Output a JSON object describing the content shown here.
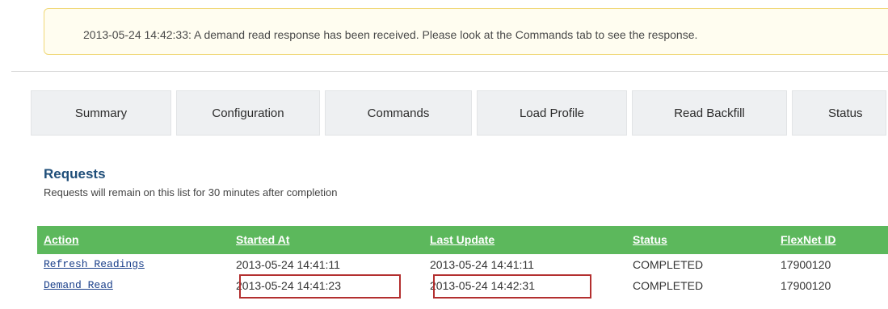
{
  "notice": {
    "text": "2013-05-24 14:42:33: A demand read response has been received. Please look at the Commands tab to see the response."
  },
  "tabs": [
    {
      "label": "Summary"
    },
    {
      "label": "Configuration"
    },
    {
      "label": "Commands"
    },
    {
      "label": "Load Profile"
    },
    {
      "label": "Read Backfill"
    },
    {
      "label": "Status"
    }
  ],
  "requests": {
    "title": "Requests",
    "subtitle": "Requests will remain on this list for 30 minutes after completion",
    "columns": [
      "Action",
      "Started At",
      "Last Update",
      "Status",
      "FlexNet ID"
    ],
    "rows": [
      {
        "action": "Refresh Readings",
        "started": "2013-05-24 14:41:11",
        "updated": "2013-05-24 14:41:11",
        "status": "COMPLETED",
        "flexnet_id": "17900120"
      },
      {
        "action": "Demand Read",
        "started": "2013-05-24 14:41:23",
        "updated": "2013-05-24 14:42:31",
        "status": "COMPLETED",
        "flexnet_id": "17900120"
      }
    ]
  },
  "colors": {
    "header_green": "#5cb85c",
    "highlight_red": "#b32f2f",
    "title_blue": "#1f4e79"
  }
}
